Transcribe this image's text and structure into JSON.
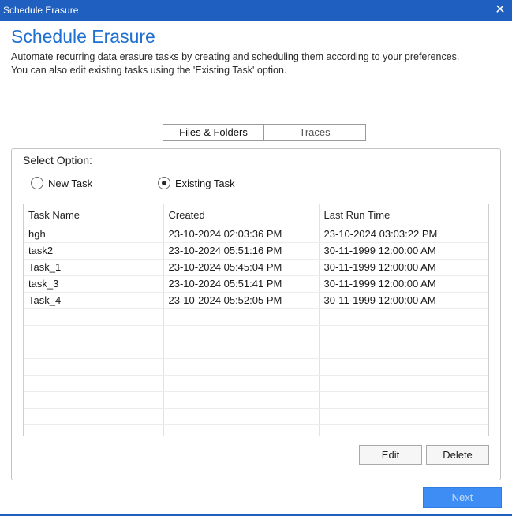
{
  "window": {
    "title": "Schedule Erasure",
    "close_glyph": "✕"
  },
  "header": {
    "heading": "Schedule Erasure",
    "description_line1": "Automate recurring data erasure tasks by creating and scheduling them according to your preferences.",
    "description_line2": "You can also edit existing tasks using the 'Existing Task' option."
  },
  "tabs": [
    {
      "label": "Files & Folders",
      "active": true
    },
    {
      "label": "Traces",
      "active": false
    }
  ],
  "options": {
    "label": "Select Option:",
    "new_task": "New Task",
    "existing_task": "Existing Task",
    "selected": "existing_task"
  },
  "table": {
    "columns": [
      "Task Name",
      "Created",
      "Last Run Time"
    ],
    "rows": [
      [
        "hgh",
        "23-10-2024 02:03:36 PM",
        "23-10-2024 03:03:22 PM"
      ],
      [
        "task2",
        "23-10-2024 05:51:16 PM",
        "30-11-1999 12:00:00 AM"
      ],
      [
        "Task_1",
        "23-10-2024 05:45:04 PM",
        "30-11-1999 12:00:00 AM"
      ],
      [
        "task_3",
        "23-10-2024 05:51:41 PM",
        "30-11-1999 12:00:00 AM"
      ],
      [
        "Task_4",
        "23-10-2024 05:52:05 PM",
        "30-11-1999 12:00:00 AM"
      ]
    ]
  },
  "buttons": {
    "edit": "Edit",
    "delete": "Delete",
    "next": "Next"
  },
  "colors": {
    "title_bar": "#1f5fbf",
    "heading": "#1f6fd0",
    "next_button": "#3d8df5"
  }
}
